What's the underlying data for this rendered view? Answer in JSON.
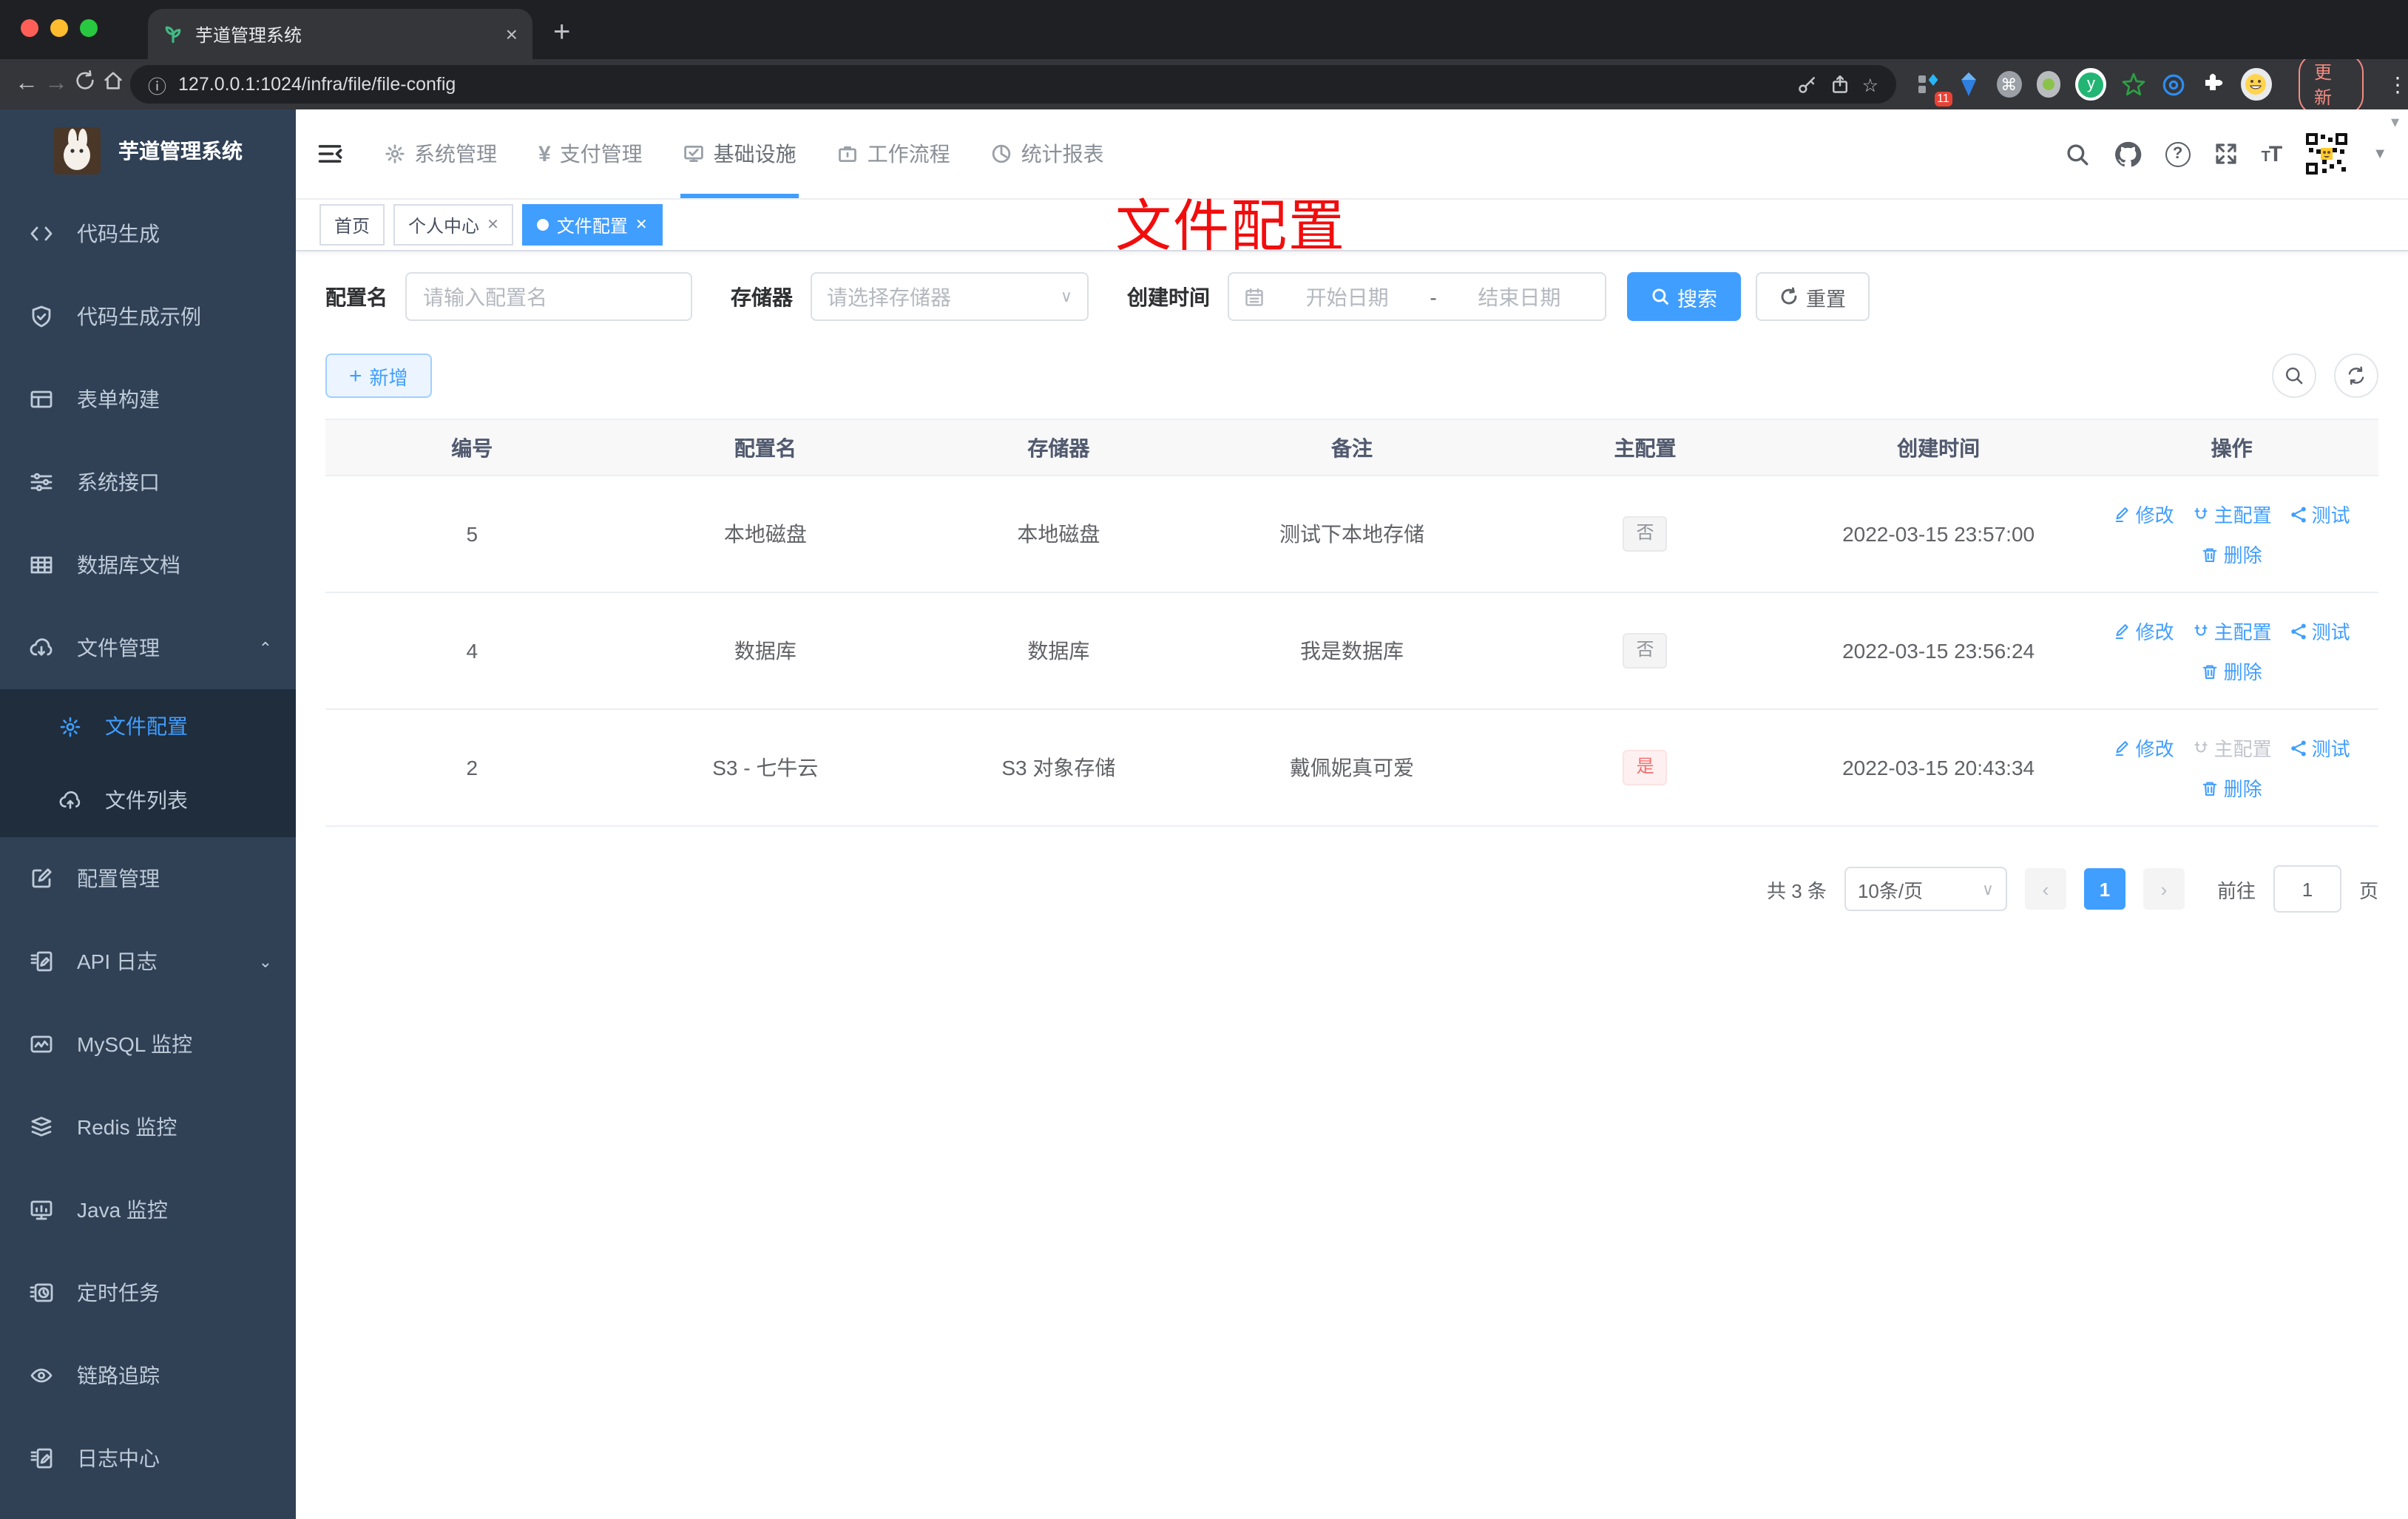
{
  "browser": {
    "tab_title": "芋道管理系统",
    "url": "127.0.0.1:1024/infra/file/file-config",
    "new_tab_label": "+",
    "close_label": "×",
    "extension_badge": "11",
    "update_button": "更新"
  },
  "sidebar": {
    "title": "芋道管理系统",
    "items": [
      {
        "label": "代码生成",
        "icon": "code-icon"
      },
      {
        "label": "代码生成示例",
        "icon": "shield-check-icon"
      },
      {
        "label": "表单构建",
        "icon": "form-icon"
      },
      {
        "label": "系统接口",
        "icon": "sliders-icon"
      },
      {
        "label": "数据库文档",
        "icon": "grid-icon"
      },
      {
        "label": "文件管理",
        "icon": "cloud-download-icon",
        "expanded": true
      },
      {
        "label": "配置管理",
        "icon": "edit-square-icon"
      },
      {
        "label": "API 日志",
        "icon": "doc-edit-icon",
        "collapsed": true
      },
      {
        "label": "MySQL 监控",
        "icon": "chart-monitor-icon"
      },
      {
        "label": "Redis 监控",
        "icon": "layers-icon"
      },
      {
        "label": "Java 监控",
        "icon": "monitor-icon"
      },
      {
        "label": "定时任务",
        "icon": "timer-icon"
      },
      {
        "label": "链路追踪",
        "icon": "eye-icon"
      },
      {
        "label": "日志中心",
        "icon": "log-edit-icon"
      }
    ],
    "file_submenu": [
      {
        "label": "文件配置",
        "icon": "gear-icon",
        "active": true
      },
      {
        "label": "文件列表",
        "icon": "cloud-upload-icon"
      }
    ]
  },
  "topnav": {
    "items": [
      {
        "label": "系统管理",
        "icon": "gear-icon"
      },
      {
        "label": "支付管理",
        "icon": "yen-icon"
      },
      {
        "label": "基础设施",
        "icon": "monitor-check-icon",
        "active": true
      },
      {
        "label": "工作流程",
        "icon": "briefcase-icon"
      },
      {
        "label": "统计报表",
        "icon": "dashboard-icon"
      }
    ]
  },
  "tags_view": [
    {
      "label": "首页",
      "closable": false
    },
    {
      "label": "个人中心",
      "closable": true
    },
    {
      "label": "文件配置",
      "closable": true,
      "active": true
    }
  ],
  "annotation": "文件配置",
  "filters": {
    "name_label": "配置名",
    "name_placeholder": "请输入配置名",
    "storage_label": "存储器",
    "storage_placeholder": "请选择存储器",
    "date_label": "创建时间",
    "date_start_placeholder": "开始日期",
    "date_separator": "-",
    "date_end_placeholder": "结束日期",
    "search_button": "搜索",
    "reset_button": "重置"
  },
  "toolbar": {
    "add_button": "新增"
  },
  "table": {
    "headers": [
      "编号",
      "配置名",
      "存储器",
      "备注",
      "主配置",
      "创建时间",
      "操作"
    ],
    "actions": {
      "edit": "修改",
      "master": "主配置",
      "test": "测试",
      "delete": "删除"
    },
    "rows": [
      {
        "no": "5",
        "name": "本地磁盘",
        "storage": "本地磁盘",
        "remark": "测试下本地存储",
        "master": "否",
        "master_style": "info",
        "created": "2022-03-15 23:57:00",
        "master_action_disabled": false
      },
      {
        "no": "4",
        "name": "数据库",
        "storage": "数据库",
        "remark": "我是数据库",
        "master": "否",
        "master_style": "info",
        "created": "2022-03-15 23:56:24",
        "master_action_disabled": false
      },
      {
        "no": "2",
        "name": "S3 - 七牛云",
        "storage": "S3 对象存储",
        "remark": "戴佩妮真可爱",
        "master": "是",
        "master_style": "danger",
        "created": "2022-03-15 20:43:34",
        "master_action_disabled": true
      }
    ]
  },
  "pagination": {
    "total": "共 3 条",
    "page_size": "10条/页",
    "current_page": "1",
    "goto_label": "前往",
    "goto_value": "1",
    "page_suffix": "页"
  },
  "colors": {
    "accent": "#409eff",
    "sidebar_bg": "#304156",
    "submenu_bg": "#1f2d3d",
    "sidebar_text": "#bfcbd9",
    "tag_info_text": "#909399",
    "tag_danger_text": "#f56c6c",
    "annotation_red": "#f20d0d",
    "update_button_red": "#f28b82"
  }
}
